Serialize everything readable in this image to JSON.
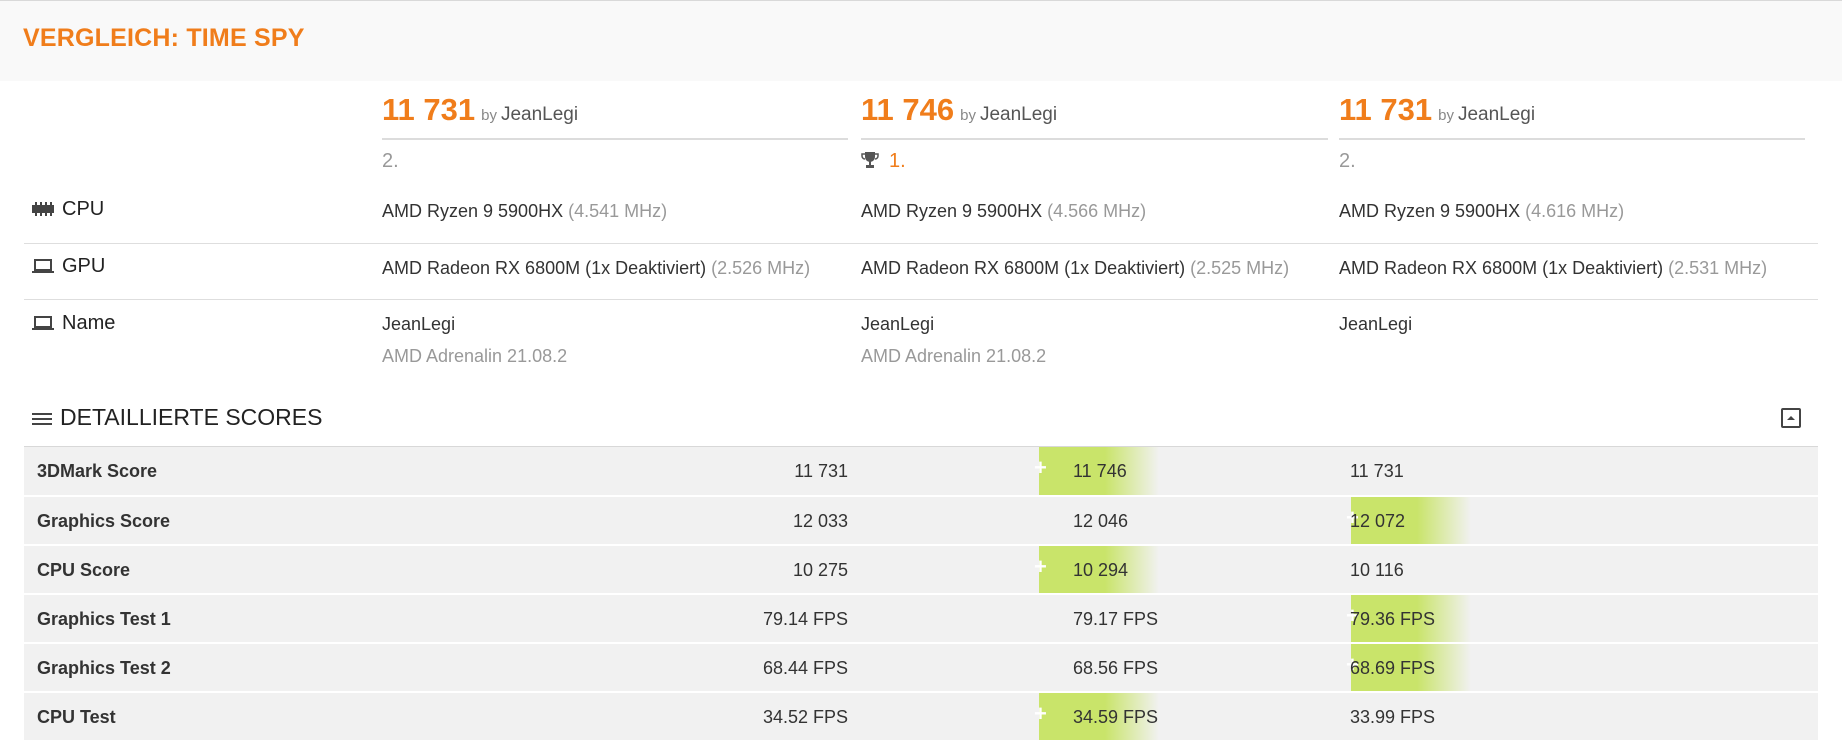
{
  "page": {
    "title": "VERGLEICH: TIME SPY"
  },
  "results": [
    {
      "score": "11 731",
      "by": "by",
      "user": "JeanLegi",
      "rank": "2."
    },
    {
      "score": "11 746",
      "by": "by",
      "user": "JeanLegi",
      "rank": "1."
    },
    {
      "score": "11 731",
      "by": "by",
      "user": "JeanLegi",
      "rank": "2."
    }
  ],
  "info": {
    "cpu": {
      "label": "CPU",
      "icon": "cpu-icon",
      "values": [
        {
          "name": "AMD Ryzen 9 5900HX",
          "clock": "(4.541 MHz)"
        },
        {
          "name": "AMD Ryzen 9 5900HX",
          "clock": "(4.566 MHz)"
        },
        {
          "name": "AMD Ryzen 9 5900HX",
          "clock": "(4.616 MHz)"
        }
      ]
    },
    "gpu": {
      "label": "GPU",
      "icon": "monitor-icon",
      "values": [
        {
          "name": "AMD Radeon RX 6800M (1x Deaktiviert)",
          "clock": "(2.526 MHz)"
        },
        {
          "name": "AMD Radeon RX 6800M (1x Deaktiviert)",
          "clock": "(2.525 MHz)"
        },
        {
          "name": "AMD Radeon RX 6800M (1x Deaktiviert)",
          "clock": "(2.531 MHz)"
        }
      ]
    },
    "name": {
      "label": "Name",
      "icon": "laptop-icon",
      "values": [
        {
          "name": "JeanLegi",
          "driver": "AMD Adrenalin 21.08.2"
        },
        {
          "name": "JeanLegi",
          "driver": "AMD Adrenalin 21.08.2"
        },
        {
          "name": "JeanLegi",
          "driver": ""
        }
      ]
    }
  },
  "detail": {
    "title": "DETAILLIERTE SCORES",
    "rows": [
      {
        "label": "3DMark Score",
        "values": [
          "11 731",
          "11 746",
          "11 731"
        ],
        "best": 1
      },
      {
        "label": "Graphics Score",
        "values": [
          "12 033",
          "12 046",
          "12 072"
        ],
        "best": 2
      },
      {
        "label": "CPU Score",
        "values": [
          "10 275",
          "10 294",
          "10 116"
        ],
        "best": 1
      },
      {
        "label": "Graphics Test 1",
        "values": [
          "79.14 FPS",
          "79.17 FPS",
          "79.36 FPS"
        ],
        "best": 2
      },
      {
        "label": "Graphics Test 2",
        "values": [
          "68.44 FPS",
          "68.56 FPS",
          "68.69 FPS"
        ],
        "best": 2
      },
      {
        "label": "CPU Test",
        "values": [
          "34.52 FPS",
          "34.59 FPS",
          "33.99 FPS"
        ],
        "best": 1
      }
    ]
  },
  "colors": {
    "accent": "#f07d1b",
    "best_highlight": "#c9e46a"
  }
}
